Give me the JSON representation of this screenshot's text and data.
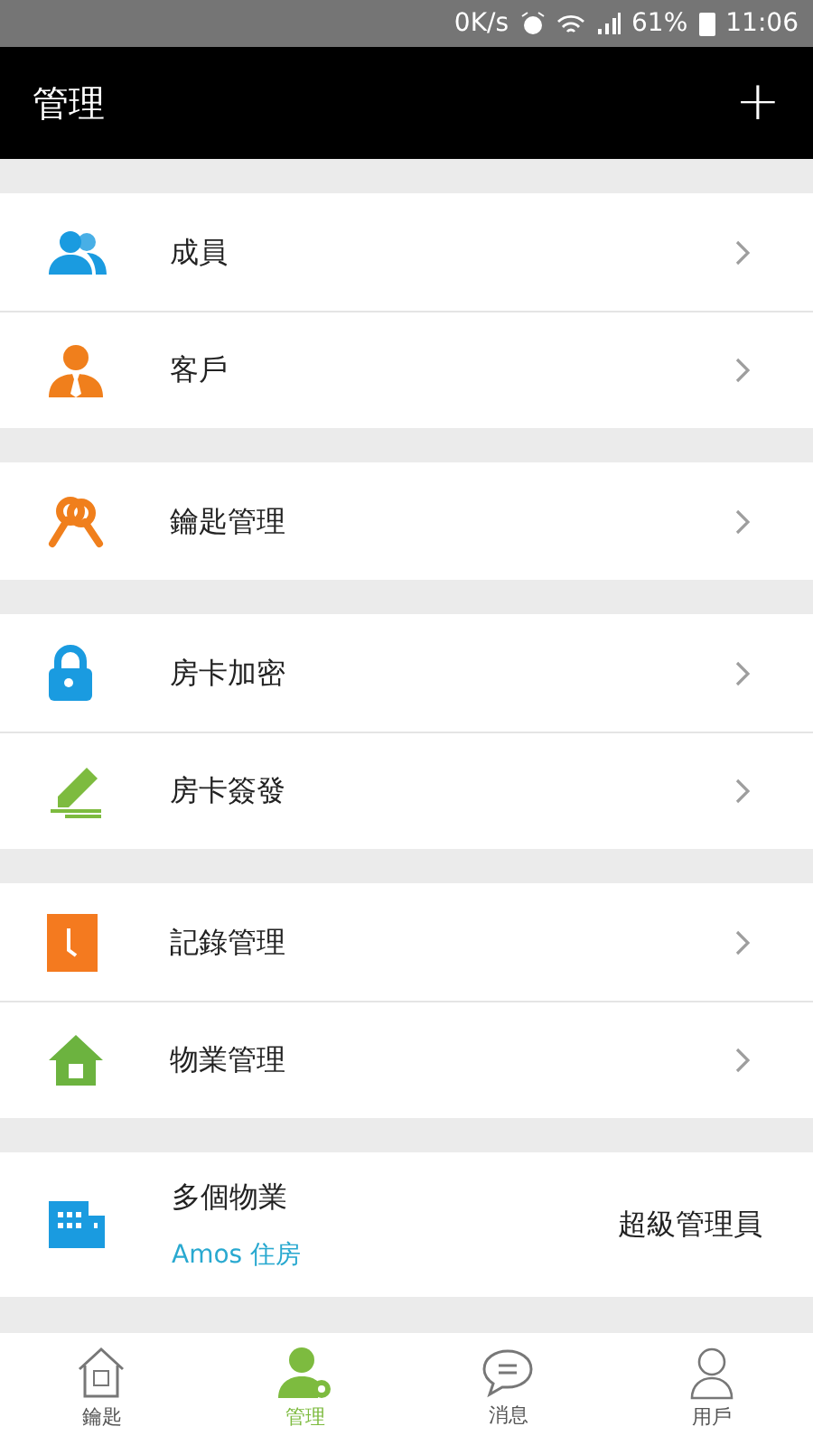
{
  "status_bar": {
    "speed": "0K/s",
    "battery": "61%",
    "time": "11:06"
  },
  "header": {
    "title": "管理",
    "action": "+"
  },
  "groups": [
    {
      "items": [
        {
          "label": "成員"
        },
        {
          "label": "客戶"
        }
      ]
    },
    {
      "items": [
        {
          "label": "鑰匙管理"
        }
      ]
    },
    {
      "items": [
        {
          "label": "房卡加密"
        },
        {
          "label": "房卡簽發"
        }
      ]
    },
    {
      "items": [
        {
          "label": "記錄管理"
        },
        {
          "label": "物業管理"
        }
      ]
    }
  ],
  "property": {
    "title": "多個物業",
    "subtitle": "Amos 住房",
    "role": "超級管理員"
  },
  "tabs": [
    {
      "label": "鑰匙",
      "selected": false
    },
    {
      "label": "管理",
      "selected": true
    },
    {
      "label": "消息",
      "selected": false
    },
    {
      "label": "用戶",
      "selected": false
    }
  ]
}
